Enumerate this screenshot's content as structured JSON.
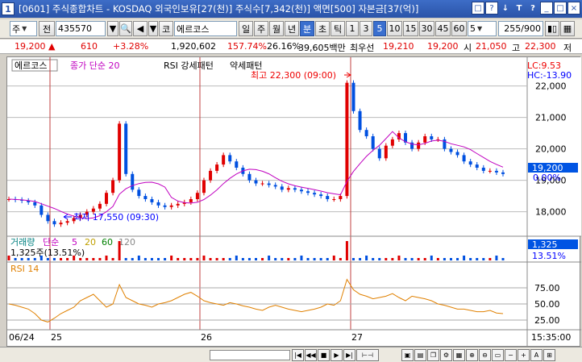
{
  "window": {
    "number": "1",
    "title": "[0601] 주식종합차트 - KOSDAQ 외국인보유[27(천)] 주식수[7,342(천)] 액면[500] 자본금[37(억)]",
    "title_buttons": [
      "□",
      "?",
      "↓",
      "T",
      "?",
      "-",
      "□",
      "×"
    ]
  },
  "toolbar": {
    "market": "주",
    "type": "전",
    "code": "435570",
    "exchange": "코",
    "stock_name": "에르코스",
    "periods": [
      "일",
      "주",
      "월",
      "년",
      "분",
      "초",
      "틱"
    ],
    "active_period": "분",
    "intervals": [
      "1",
      "3",
      "5",
      "10",
      "15",
      "30",
      "45",
      "60"
    ],
    "active_interval": "5",
    "custom_interval": "5",
    "count": "255",
    "total": "/900"
  },
  "infobar": {
    "price": "19,200",
    "change_sign": "▲",
    "change": "610",
    "change_pct": "+3.28%",
    "volume": "1,920,602",
    "volume_pct": "157.74%",
    "turnover": "26.16%",
    "amount": "39,605백만",
    "pref_label": "최우선",
    "best_ask": "19,210",
    "best_bid": "19,200",
    "open_label": "시",
    "open": "21,050",
    "high_label": "고",
    "high": "22,300",
    "low_label": "저"
  },
  "chart": {
    "stock_label": "에르코스",
    "ma_label": "종가 단순 20",
    "pattern_label": "RSI 강세패턴",
    "pattern_label2": "약세패턴",
    "lc": "LC:9.53",
    "hc": "HC:-13.90",
    "high_annot": "최고 22,300 (09:00)",
    "low_annot": "최저 17,550 (09:30)",
    "y_ticks": [
      "22,000",
      "21,000",
      "20,000",
      "19,000",
      "18,000"
    ],
    "current_price": "19,200",
    "current_pct": "0.00%",
    "volume_label": "거래량",
    "volume_ma": "단순",
    "volume_ma_periods": [
      "5",
      "20",
      "60",
      "120"
    ],
    "volume_value": "1,325주(13.51%)",
    "volume_box": "1,325",
    "volume_box_pct": "13.51%",
    "rsi_label": "RSI 14",
    "rsi_ticks": [
      "75.00",
      "50.00",
      "25.00"
    ],
    "x_labels": [
      "06/24",
      "25",
      "26",
      "27"
    ],
    "time_label": "15:35:00"
  },
  "chart_data": {
    "type": "candlestick",
    "price_range": [
      17400,
      22400
    ],
    "candles_close": [
      18400,
      18380,
      18350,
      18300,
      18200,
      17900,
      17700,
      17600,
      17650,
      17700,
      17800,
      17900,
      18000,
      18100,
      18250,
      18600,
      19000,
      20800,
      19200,
      18700,
      18500,
      18400,
      18300,
      18200,
      18150,
      18200,
      18250,
      18300,
      18400,
      18600,
      19000,
      19300,
      19500,
      19800,
      19600,
      19400,
      19200,
      19000,
      18900,
      18900,
      18850,
      18800,
      18700,
      18750,
      18700,
      18650,
      18600,
      18550,
      18500,
      18400,
      18400,
      18500,
      22100,
      21200,
      20600,
      20400,
      20000,
      19700,
      20100,
      20300,
      20500,
      20200,
      20000,
      20200,
      20400,
      20300,
      20300,
      20000,
      19900,
      19800,
      19600,
      19500,
      19400,
      19300,
      19300,
      19250,
      19200
    ],
    "rsi_values": [
      50,
      48,
      45,
      42,
      35,
      25,
      22,
      28,
      35,
      40,
      45,
      55,
      60,
      65,
      55,
      45,
      50,
      80,
      60,
      55,
      50,
      48,
      45,
      50,
      52,
      55,
      60,
      65,
      68,
      62,
      55,
      52,
      50,
      48,
      52,
      50,
      47,
      45,
      42,
      40,
      45,
      48,
      45,
      42,
      40,
      38,
      40,
      42,
      45,
      50,
      48,
      55,
      88,
      72,
      65,
      62,
      58,
      60,
      62,
      66,
      60,
      55,
      62,
      60,
      58,
      55,
      50,
      48,
      45,
      42,
      42,
      40,
      38,
      38,
      40,
      36,
      35
    ]
  }
}
